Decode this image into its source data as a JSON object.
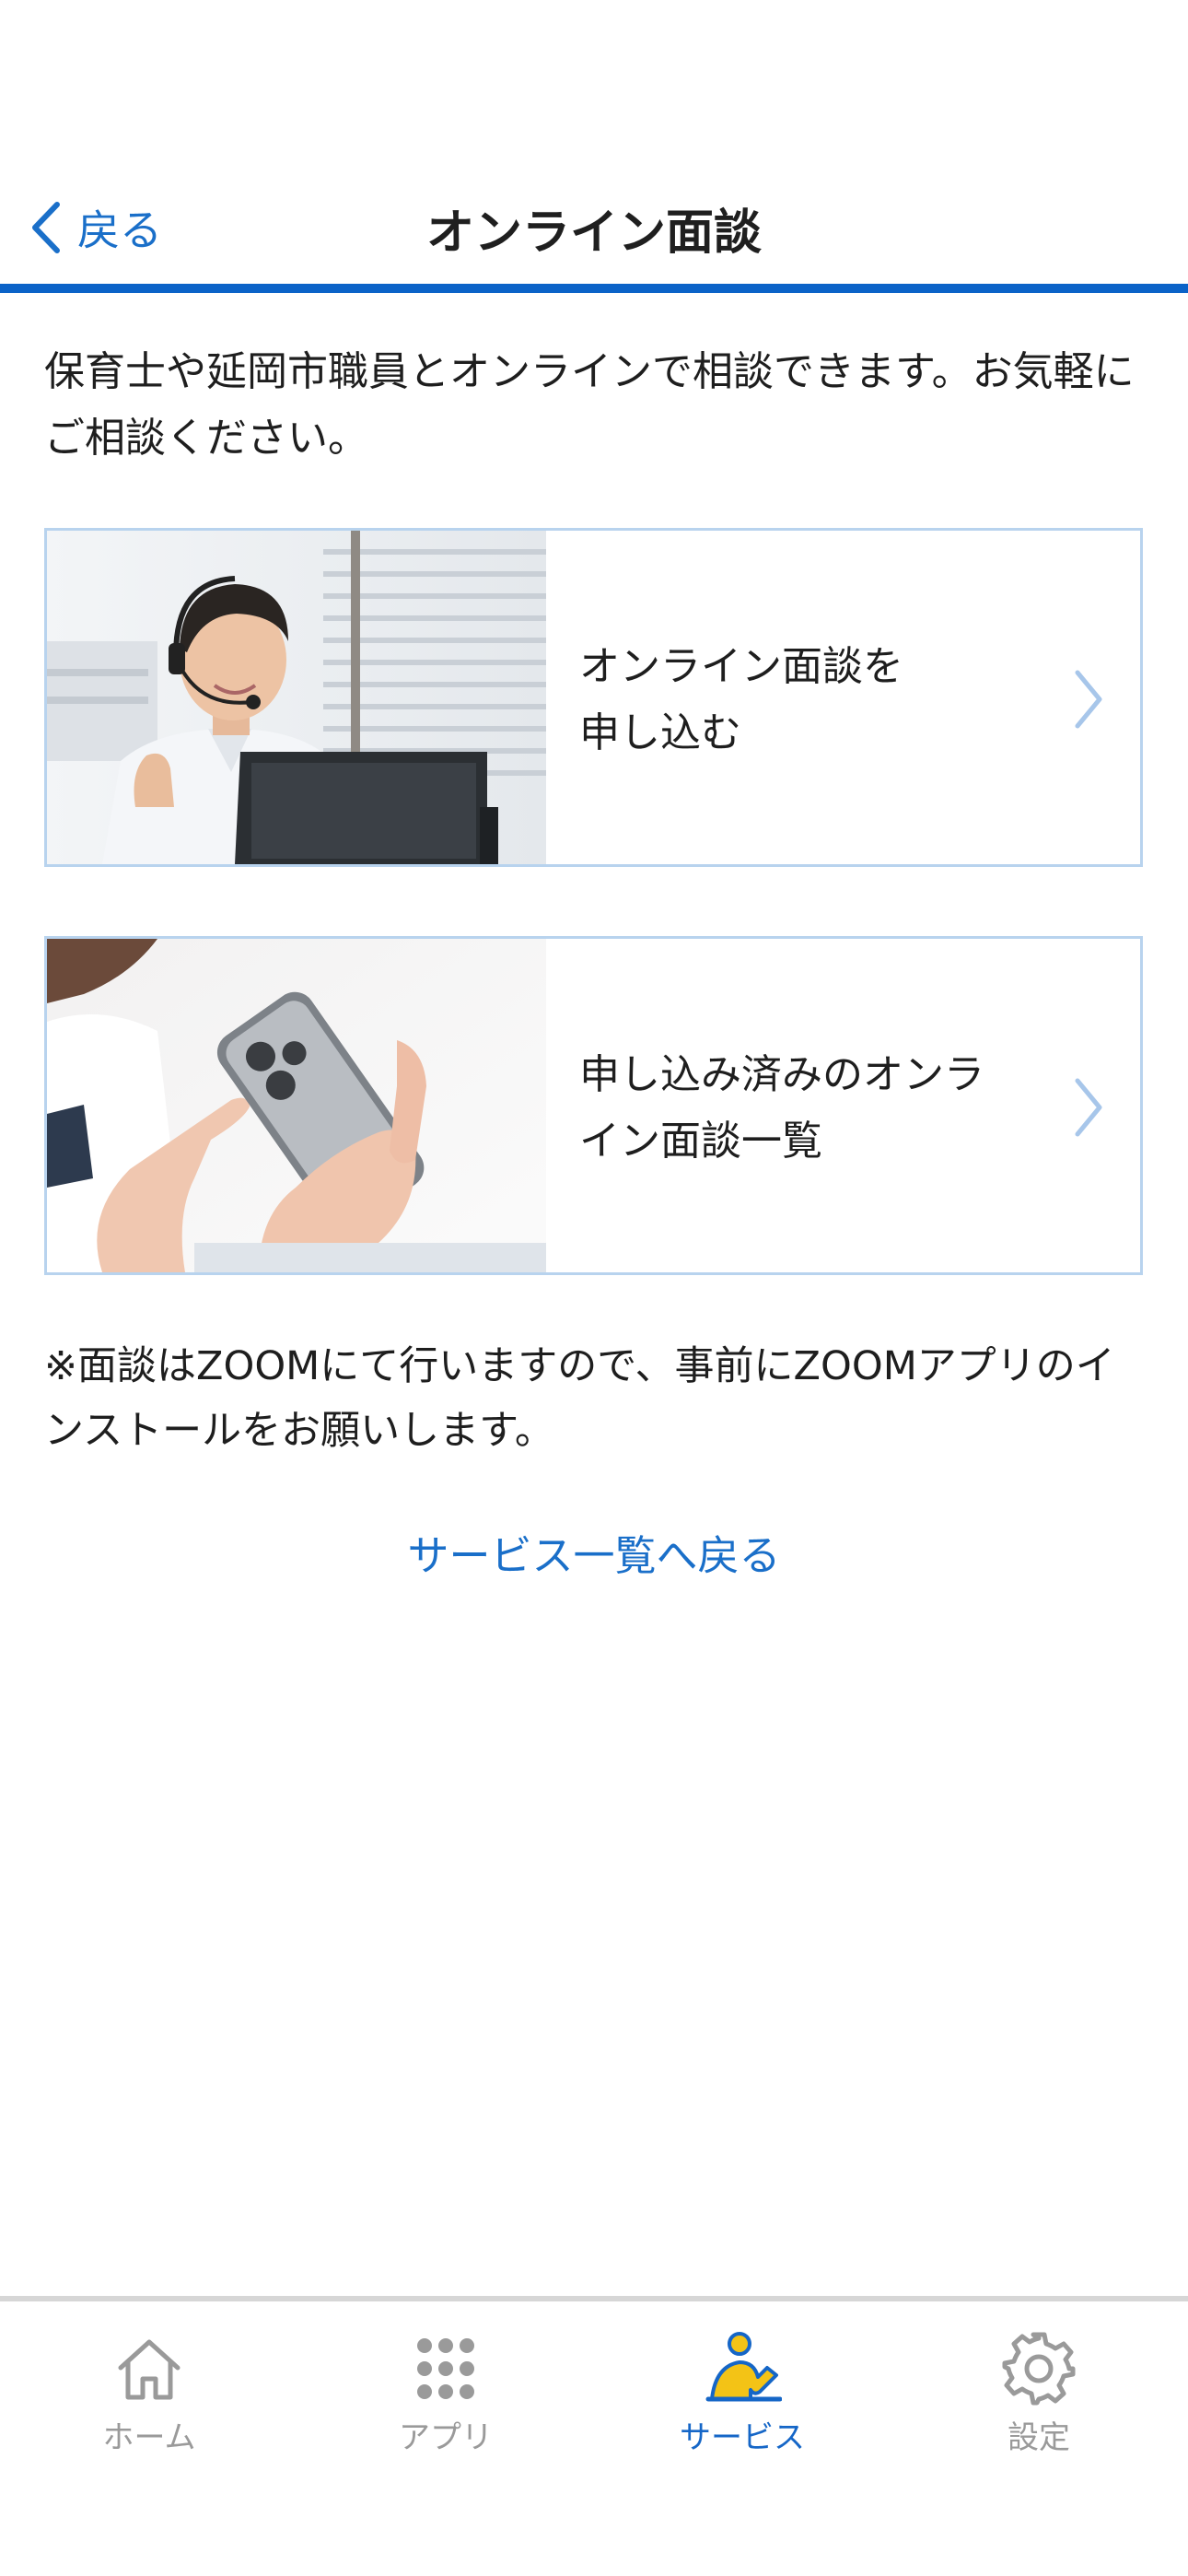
{
  "header": {
    "back_label": "戻る",
    "title": "オンライン面談"
  },
  "intro": "保育士や延岡市職員とオンラインで相談できます。お気軽にご相談ください。",
  "cards": [
    {
      "label_line1": "オンライン面談を",
      "label_line2": "申し込む",
      "image": "headset-staff-photo"
    },
    {
      "label_line1": "申し込み済みのオンラ",
      "label_line2": "イン面談一覧",
      "image": "smartphone-hands-photo"
    }
  ],
  "note": "※面談はZOOMにて行いますので、事前にZOOMアプリのインストールをお願いします。",
  "return_link": "サービス一覧へ戻る",
  "tab_bar": {
    "items": [
      {
        "label": "ホーム",
        "icon": "home-icon",
        "active": false
      },
      {
        "label": "アプリ",
        "icon": "apps-grid-icon",
        "active": false
      },
      {
        "label": "サービス",
        "icon": "service-person-icon",
        "active": true
      },
      {
        "label": "設定",
        "icon": "gear-icon",
        "active": false
      }
    ]
  },
  "colors": {
    "accent": "#1a6fc9",
    "header_rule": "#0b63c8",
    "card_border": "#b8d3ee",
    "tab_inactive": "#9a9a9a",
    "tab_active_figure": "#f3c316"
  }
}
